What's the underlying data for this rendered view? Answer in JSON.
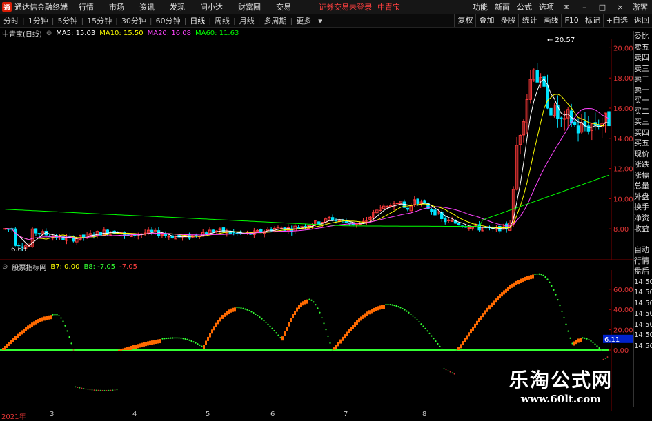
{
  "titlebar": {
    "app_title": "通达信金融终端",
    "menus": [
      "行情",
      "市场",
      "资讯",
      "发现",
      "问小达",
      "财富圈",
      "交易"
    ],
    "warning": "证券交易未登录",
    "stock_name": "中青宝",
    "right_items": [
      "功能",
      "新面",
      "公式",
      "选项"
    ],
    "guest": "游客"
  },
  "periods": [
    "分时",
    "1分钟",
    "5分钟",
    "15分钟",
    "30分钟",
    "60分钟",
    "日线",
    "周线",
    "月线",
    "多周期",
    "更多"
  ],
  "active_period": "日线",
  "tools": [
    "复权",
    "叠加",
    "多股",
    "统计",
    "画线",
    "F10",
    "标记",
    "+自选",
    "返回"
  ],
  "ma_header": {
    "title": "中青宝(日线)",
    "ma5": "MA5: 15.03",
    "ma10": "MA10: 15.50",
    "ma20": "MA20: 16.08",
    "ma60": "MA60: 11.63"
  },
  "price_axis": [
    "20.00",
    "18.00",
    "16.00",
    "14.00",
    "12.00",
    "10.00",
    "8.00"
  ],
  "high_label": "20.57",
  "low_label": "6.68",
  "indicator_header": {
    "name": "股票指标网",
    "b7": "B7: 0.00",
    "b8": "B8: -7.05",
    "val": "-7.05"
  },
  "ind_axis": [
    "60.00",
    "40.00",
    "20.00",
    "0.00"
  ],
  "ind_current": "6.11",
  "right_panel": [
    "委比",
    "卖五",
    "卖四",
    "卖三",
    "卖二",
    "卖一",
    "买一",
    "买二",
    "买三",
    "买四",
    "买五",
    "现价",
    "涨跌",
    "涨幅",
    "总量",
    "外盘",
    "换手",
    "净资",
    "收益",
    "",
    "自动",
    "行情",
    "盘后",
    "14:50",
    "14:50",
    "14:50",
    "14:50",
    "14:50",
    "14:50",
    "14:50"
  ],
  "date_labels": [
    "2021年",
    "3",
    "4",
    "5",
    "6",
    "7",
    "8"
  ],
  "watermark": {
    "cn": "乐淘公式网",
    "url": "www.60lt.com"
  },
  "colors": {
    "ma5": "#ffffff",
    "ma10": "#ffff00",
    "ma20": "#ff44ff",
    "ma60": "#00ff00",
    "up": "#ff3b3b",
    "down": "#00e5ff",
    "ind_up": "#ff6a00",
    "ind_flat": "#33ff33"
  }
}
